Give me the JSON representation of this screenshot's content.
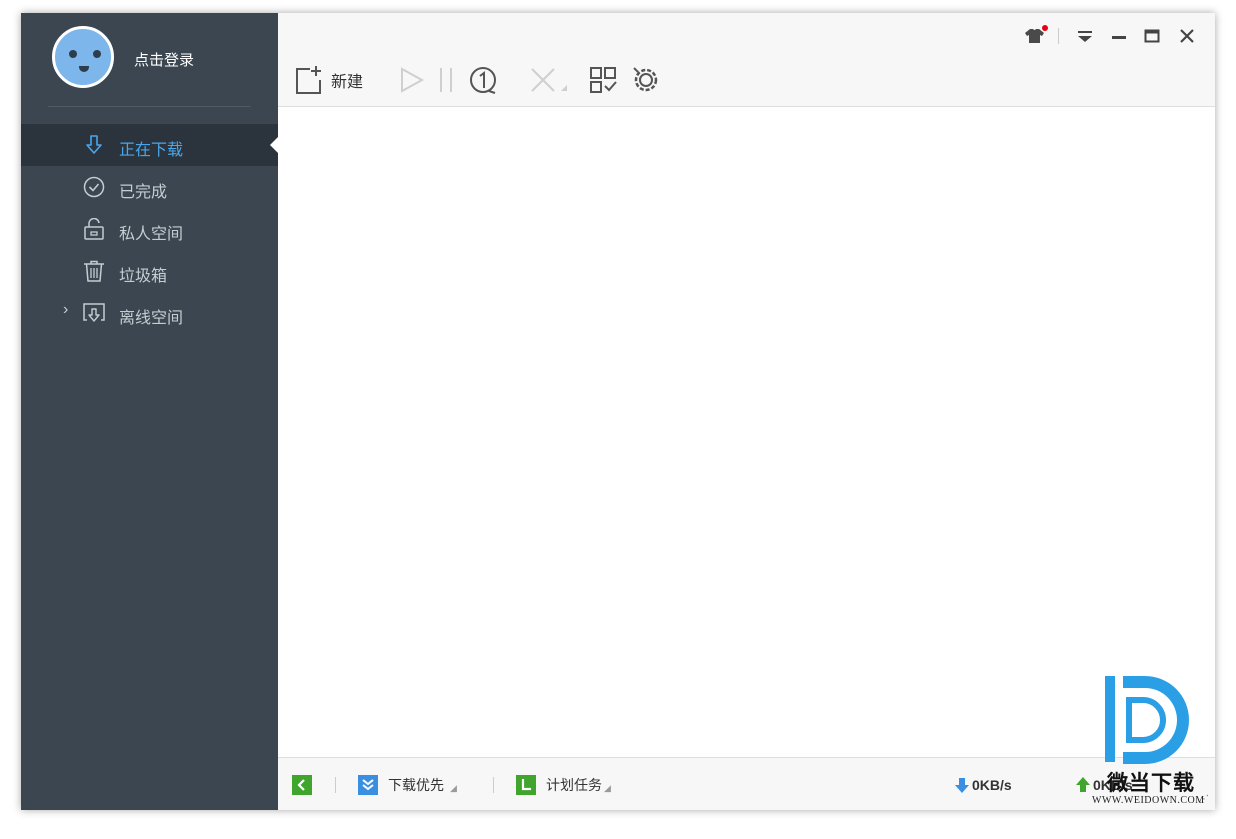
{
  "sidebar": {
    "login_text": "点击登录",
    "items": [
      {
        "label": "正在下载",
        "icon": "download-arrow-icon",
        "active": true
      },
      {
        "label": "已完成",
        "icon": "check-circle-icon",
        "active": false
      },
      {
        "label": "私人空间",
        "icon": "lock-icon",
        "active": false
      },
      {
        "label": "垃圾箱",
        "icon": "trash-icon",
        "active": false
      },
      {
        "label": "离线空间",
        "icon": "offline-download-icon",
        "active": false,
        "expandable": true
      }
    ]
  },
  "toolbar": {
    "new_label": "新建",
    "icons": [
      "new-icon",
      "play-icon",
      "pause-icon",
      "limit-icon",
      "delete-icon",
      "qrcode-icon",
      "settings-icon"
    ]
  },
  "window_controls": [
    "skin-icon",
    "menu-icon",
    "minimize-icon",
    "maximize-icon",
    "close-icon"
  ],
  "statusbar": {
    "priority_label": "下载优先",
    "schedule_label": "计划任务",
    "download_speed": "0KB/s",
    "upload_speed": "0KB/s"
  },
  "watermark": {
    "name": "微当下载",
    "url": "WWW.WEIDOWN.COM"
  },
  "colors": {
    "sidebar_bg": "#3b4650",
    "active_bg": "#2b343c",
    "accent": "#4aa6ec",
    "green": "#3fa52d",
    "notification": "#e60012"
  }
}
